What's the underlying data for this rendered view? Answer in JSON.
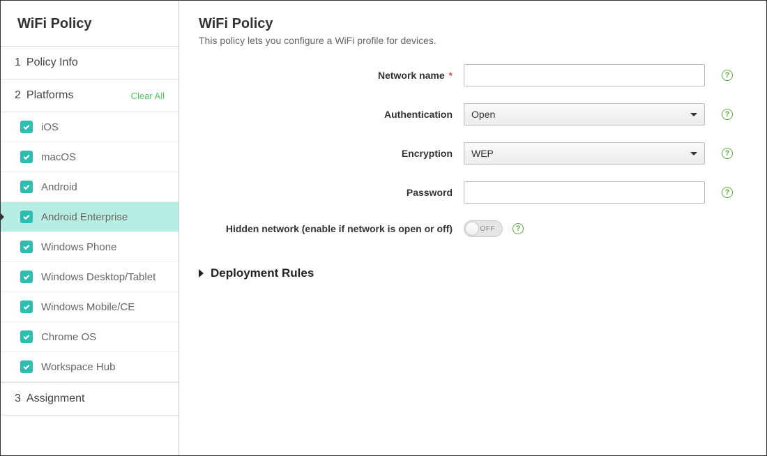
{
  "sidebar": {
    "title": "WiFi Policy",
    "steps": {
      "one": {
        "num": "1",
        "label": "Policy Info"
      },
      "two": {
        "num": "2",
        "label": "Platforms",
        "clear_all": "Clear All"
      },
      "three": {
        "num": "3",
        "label": "Assignment"
      }
    },
    "platforms": [
      {
        "label": "iOS"
      },
      {
        "label": "macOS"
      },
      {
        "label": "Android"
      },
      {
        "label": "Android Enterprise"
      },
      {
        "label": "Windows Phone"
      },
      {
        "label": "Windows Desktop/Tablet"
      },
      {
        "label": "Windows Mobile/CE"
      },
      {
        "label": "Chrome OS"
      },
      {
        "label": "Workspace Hub"
      }
    ]
  },
  "main": {
    "title": "WiFi Policy",
    "subtitle": "This policy lets you configure a WiFi profile for devices.",
    "fields": {
      "network_name": {
        "label": "Network name",
        "value": ""
      },
      "authentication": {
        "label": "Authentication",
        "value": "Open"
      },
      "encryption": {
        "label": "Encryption",
        "value": "WEP"
      },
      "password": {
        "label": "Password",
        "value": ""
      },
      "hidden_network": {
        "label": "Hidden network (enable if network is open or off)",
        "value": "OFF"
      }
    },
    "deployment_rules": "Deployment Rules",
    "required_marker": "*",
    "help_glyph": "?"
  }
}
